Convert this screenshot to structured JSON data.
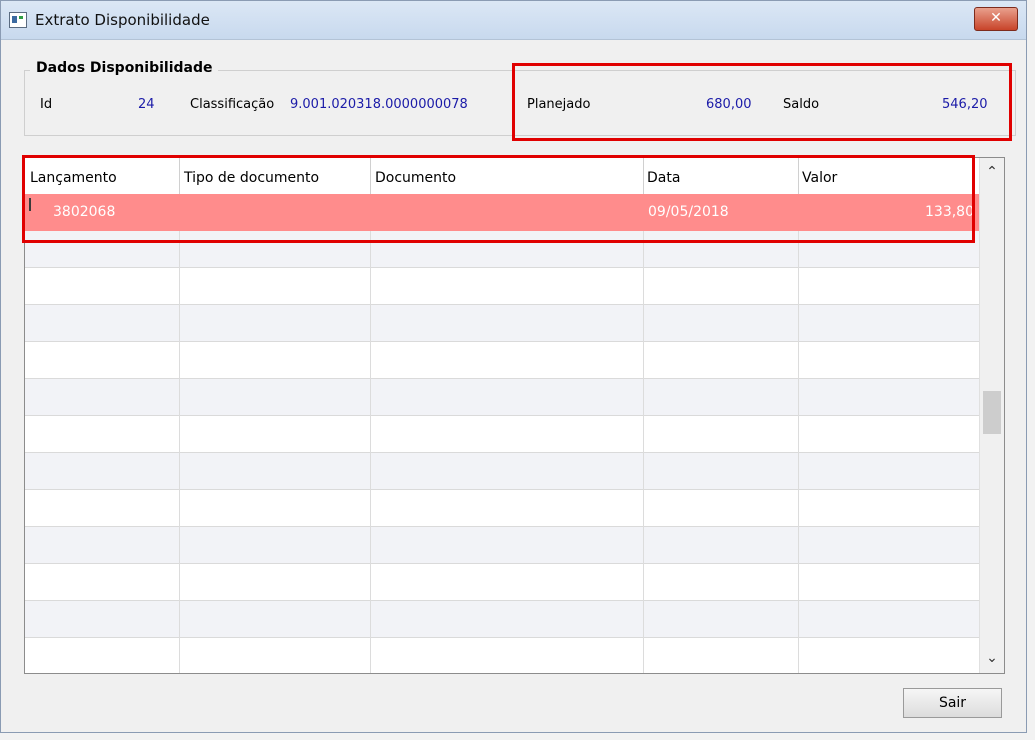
{
  "window": {
    "title": "Extrato Disponibilidade",
    "close_label": "✕"
  },
  "dados": {
    "group_title": "Dados Disponibilidade",
    "id_label": "Id",
    "id_value": "24",
    "classificacao_label": "Classificação",
    "classificacao_value": "9.001.020318.0000000078",
    "planejado_label": "Planejado",
    "planejado_value": "680,00",
    "saldo_label": "Saldo",
    "saldo_value": "546,20"
  },
  "grid": {
    "columns": [
      "Lançamento",
      "Tipo de documento",
      "Documento",
      "Data",
      "Valor"
    ],
    "rows": [
      {
        "lancamento": "3802068",
        "tipo": "",
        "documento": "",
        "data": "09/05/2018",
        "valor": "133,80"
      }
    ],
    "scroll_up": "⌃",
    "scroll_down": "⌄"
  },
  "buttons": {
    "sair": "Sair"
  },
  "colors": {
    "selected_row": "#ff8c8c",
    "highlight": "#e00000",
    "value_text": "#1b1ba8"
  }
}
